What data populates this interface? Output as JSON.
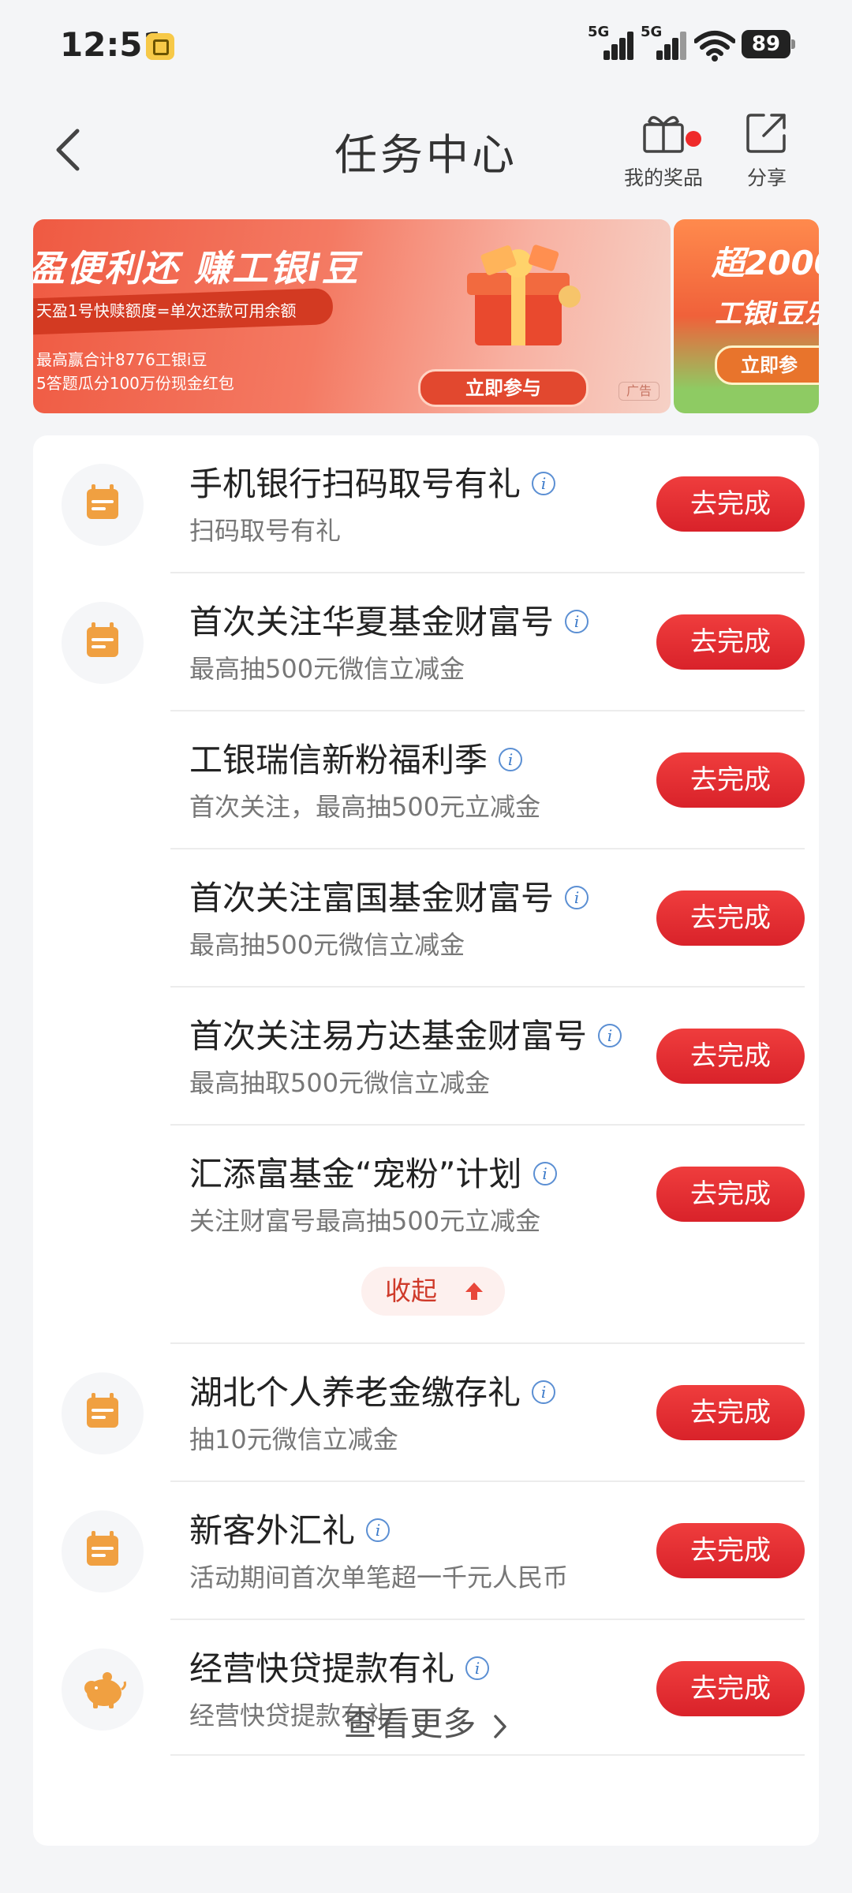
{
  "status_bar": {
    "time": "12:51",
    "network1": "5G",
    "network2": "5G",
    "battery": "89"
  },
  "header": {
    "title": "任务中心",
    "prizes_label": "我的奖品",
    "share_label": "分享"
  },
  "banner": {
    "headline": "盈便利还 赚工银i豆",
    "subline": "天盈1号快赎额度=单次还款可用余额",
    "desc1": "最高赢合计8776工银i豆",
    "desc2": "5答题瓜分100万份现金红包",
    "cta": "立即参与",
    "ad_tag": "广告",
    "next_title": "超2000",
    "next_sub": "工银i豆乐",
    "next_cta": "立即参"
  },
  "tasks": [
    {
      "title": "手机银行扫码取号有礼",
      "subtitle": "扫码取号有礼",
      "button": "去完成",
      "icon": "calendar-icon"
    },
    {
      "title": "首次关注华夏基金财富号",
      "subtitle": "最高抽500元微信立减金",
      "button": "去完成",
      "icon": "calendar-icon"
    },
    {
      "title": "工银瑞信新粉福利季",
      "subtitle": "首次关注，最高抽500元立减金",
      "button": "去完成"
    },
    {
      "title": "首次关注富国基金财富号",
      "subtitle": "最高抽500元微信立减金",
      "button": "去完成"
    },
    {
      "title": "首次关注易方达基金财富号",
      "subtitle": "最高抽取500元微信立减金",
      "button": "去完成"
    },
    {
      "title": "汇添富基金“宠粉”计划",
      "subtitle": "关注财富号最高抽500元立减金",
      "button": "去完成"
    },
    {
      "title": "湖北个人养老金缴存礼",
      "subtitle": "抽10元微信立减金",
      "button": "去完成",
      "icon": "calendar-icon"
    },
    {
      "title": "新客外汇礼",
      "subtitle": "活动期间首次单笔超一千元人民币",
      "button": "去完成",
      "icon": "calendar-icon"
    },
    {
      "title": "经营快贷提款有礼",
      "subtitle": "经营快贷提款有礼",
      "button": "去完成",
      "icon": "piggy-bank-icon"
    }
  ],
  "collapse_label": "收起",
  "view_more_label": "查看更多",
  "colors": {
    "accent_red": "#e3282e",
    "icon_orange": "#f0a041",
    "info_blue": "#3a79c9"
  }
}
